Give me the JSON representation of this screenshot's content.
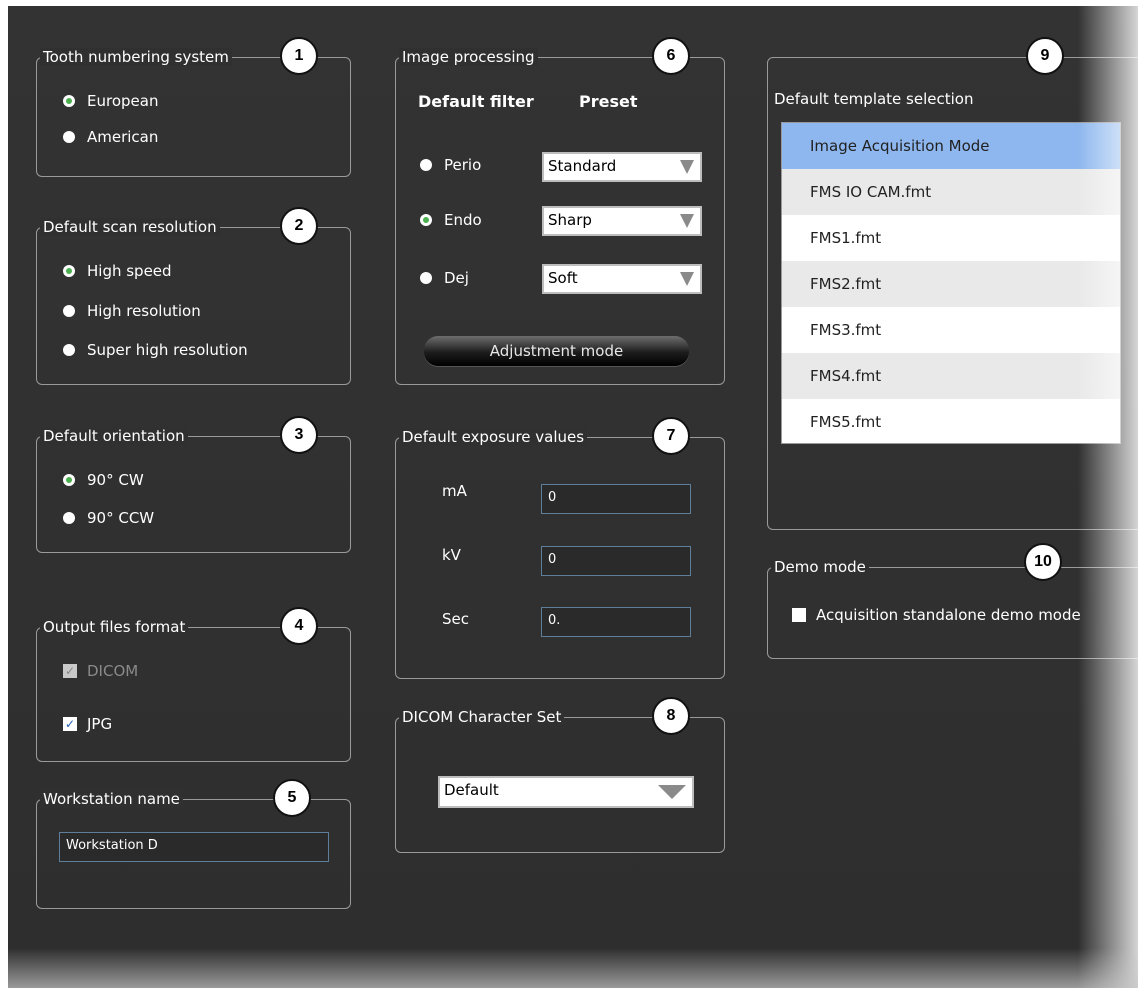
{
  "tooth_numbering": {
    "title": "Tooth numbering system",
    "badge": "1",
    "options": [
      "European",
      "American"
    ],
    "selected": "European"
  },
  "scan_resolution": {
    "title": "Default scan resolution",
    "badge": "2",
    "options": [
      "High speed",
      "High resolution",
      "Super high resolution"
    ],
    "selected": "High speed"
  },
  "orientation": {
    "title": "Default orientation",
    "badge": "3",
    "options": [
      "90° CW",
      "90° CCW"
    ],
    "selected": "90° CW"
  },
  "output_format": {
    "title": "Output files format",
    "badge": "4",
    "dicom_label": "DICOM",
    "jpg_label": "JPG"
  },
  "workstation": {
    "title": "Workstation name",
    "badge": "5",
    "value": "Workstation D"
  },
  "image_processing": {
    "title": "Image processing",
    "badge": "6",
    "col_filter": "Default filter",
    "col_preset": "Preset",
    "filters": [
      {
        "name": "Perio",
        "preset": "Standard"
      },
      {
        "name": "Endo",
        "preset": "Sharp"
      },
      {
        "name": "Dej",
        "preset": "Soft"
      }
    ],
    "selected": "Endo",
    "adjust_button": "Adjustment mode"
  },
  "exposure": {
    "title": "Default exposure values",
    "badge": "7",
    "ma_label": "mA",
    "ma_value": "0",
    "kv_label": "kV",
    "kv_value": "0",
    "sec_label": "Sec",
    "sec_value": "0."
  },
  "dicom_charset": {
    "title": "DICOM Character Set",
    "badge": "8",
    "value": "Default"
  },
  "template": {
    "badge": "9",
    "label": "Default template selection",
    "items": [
      "Image Acquisition Mode",
      "FMS IO CAM.fmt",
      "FMS1.fmt",
      "FMS2.fmt",
      "FMS3.fmt",
      "FMS4.fmt",
      "FMS5.fmt"
    ],
    "selected_index": 0
  },
  "demo": {
    "title": "Demo mode",
    "badge": "10",
    "checkbox_label": "Acquisition standalone demo mode"
  },
  "colors": {
    "panel": "#303030",
    "selected_row": "#8db7ee",
    "radio_selected": "#4caf50"
  }
}
